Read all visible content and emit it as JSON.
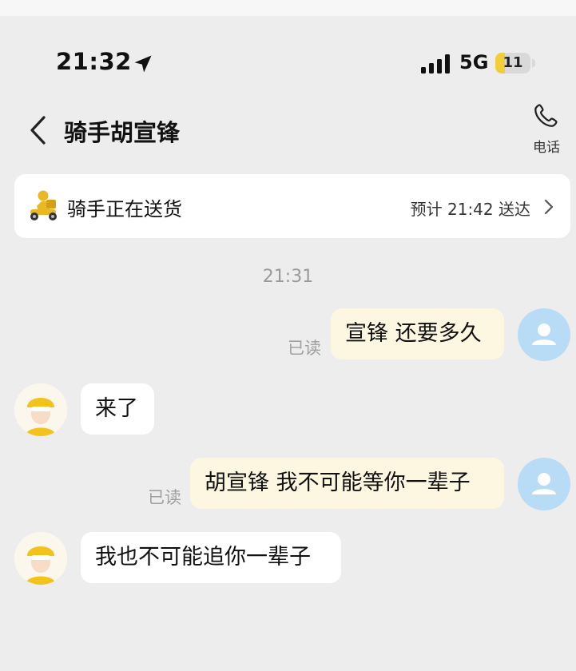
{
  "status_bar": {
    "time": "21:32",
    "network": "5G",
    "battery": "11",
    "battery_percent": 11
  },
  "header": {
    "title": "骑手胡宣锋",
    "call_label": "电话"
  },
  "delivery": {
    "status": "骑手正在送货",
    "eta": "预计 21:42 送达"
  },
  "chat": {
    "timestamp": "21:31",
    "messages": [
      {
        "sender": "me",
        "text": "宣锋 还要多久",
        "read": "已读"
      },
      {
        "sender": "rider",
        "text": "来了"
      },
      {
        "sender": "me",
        "text": "胡宣锋 我不可能等你一辈子",
        "read": "已读"
      },
      {
        "sender": "rider",
        "text": "我也不可能追你一辈子"
      }
    ]
  },
  "icons": [
    "location-arrow-icon",
    "signal-icon",
    "back-icon",
    "phone-icon",
    "scooter-icon",
    "chevron-right-icon",
    "user-avatar-icon",
    "rider-avatar-icon"
  ],
  "colors": {
    "background": "#ededed",
    "outgoing_bubble": "#fdf6e0",
    "incoming_bubble": "#ffffff",
    "user_avatar": "#b8dcf5",
    "brand_yellow": "#f2ce3a"
  }
}
